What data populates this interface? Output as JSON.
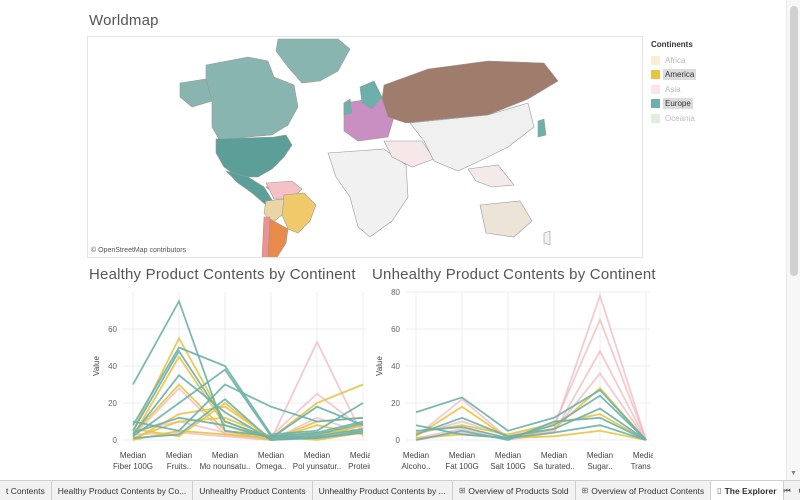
{
  "worldmap": {
    "title": "Worldmap",
    "credit": "© OpenStreetMap contributors"
  },
  "legend": {
    "title": "Continents",
    "items": [
      {
        "label": "Africa",
        "color": "#e8cf8a",
        "state": "dim"
      },
      {
        "label": "America",
        "color": "#e8c442",
        "state": "sel"
      },
      {
        "label": "Asia",
        "color": "#f2b8bd",
        "state": "dim"
      },
      {
        "label": "Europe",
        "color": "#6bb0aa",
        "state": "sel"
      },
      {
        "label": "Oceania",
        "color": "#a7cfa3",
        "state": "dim"
      }
    ]
  },
  "colors": {
    "america": "#e8c442",
    "europe": "#6bb0aa",
    "asia": "#f2b8bd",
    "russia": "#a07c6c",
    "greenland": "#89b5b1",
    "canada": "#89b5b1",
    "usa": "#5c9f99",
    "brazil": "#f0c96a",
    "argentina": "#e88a49",
    "chile": "#f09090",
    "grid": "#ececec"
  },
  "chart_data": [
    {
      "type": "line",
      "title": "Healthy Product Contents by Continent",
      "ylabel": "Value",
      "ylim": [
        0,
        80
      ],
      "yticks": [
        0,
        20,
        40,
        60
      ],
      "categories": [
        "Median Fiber 100G",
        "Median Fruits..",
        "Median Mo nounsatu..",
        "Median Omega..",
        "Median Pol yunsatur..",
        "Median Protein.."
      ],
      "series": [
        {
          "group": "europe",
          "values": [
            30,
            75,
            5,
            2,
            4,
            10
          ]
        },
        {
          "group": "europe",
          "values": [
            8,
            50,
            40,
            3,
            5,
            20
          ]
        },
        {
          "group": "europe",
          "values": [
            5,
            48,
            10,
            1,
            18,
            8
          ]
        },
        {
          "group": "europe",
          "values": [
            3,
            35,
            15,
            0,
            2,
            6
          ]
        },
        {
          "group": "europe",
          "values": [
            2,
            20,
            38,
            2,
            1,
            5
          ]
        },
        {
          "group": "europe",
          "values": [
            10,
            5,
            30,
            18,
            10,
            12
          ]
        },
        {
          "group": "europe",
          "values": [
            4,
            12,
            8,
            1,
            3,
            9
          ]
        },
        {
          "group": "europe",
          "values": [
            1,
            3,
            22,
            0,
            1,
            4
          ]
        },
        {
          "group": "america",
          "values": [
            5,
            55,
            10,
            1,
            20,
            30
          ]
        },
        {
          "group": "america",
          "values": [
            2,
            45,
            8,
            0,
            2,
            8
          ]
        },
        {
          "group": "america",
          "values": [
            0,
            14,
            18,
            1,
            4,
            5
          ]
        },
        {
          "group": "america",
          "values": [
            3,
            30,
            5,
            0,
            10,
            12
          ]
        },
        {
          "group": "america",
          "values": [
            1,
            10,
            12,
            2,
            0,
            4
          ]
        },
        {
          "group": "america",
          "values": [
            6,
            2,
            20,
            0,
            8,
            3
          ]
        },
        {
          "group": "america",
          "values": [
            0,
            5,
            3,
            1,
            2,
            8
          ]
        },
        {
          "group": "asia",
          "values": [
            3,
            4,
            2,
            0,
            53,
            2
          ]
        },
        {
          "group": "asia",
          "values": [
            5,
            10,
            4,
            2,
            25,
            6
          ]
        },
        {
          "group": "asia",
          "values": [
            2,
            28,
            3,
            0,
            12,
            4
          ]
        }
      ]
    },
    {
      "type": "line",
      "title": "Unhealthy Product Contents by Continent",
      "ylabel": "Value",
      "ylim": [
        0,
        80
      ],
      "yticks": [
        0,
        20,
        40,
        60,
        80
      ],
      "categories": [
        "Median Alcoho..",
        "Median Fat 100G",
        "Median Salt 100G",
        "Median Sa turated..",
        "Median Sugar..",
        "Median Trans F.."
      ],
      "series": [
        {
          "group": "europe",
          "values": [
            15,
            23,
            5,
            12,
            27,
            0
          ]
        },
        {
          "group": "europe",
          "values": [
            5,
            7,
            1,
            8,
            24,
            0
          ]
        },
        {
          "group": "europe",
          "values": [
            3,
            12,
            2,
            6,
            17,
            0
          ]
        },
        {
          "group": "europe",
          "values": [
            0,
            5,
            0,
            10,
            12,
            0
          ]
        },
        {
          "group": "europe",
          "values": [
            8,
            3,
            1,
            4,
            8,
            0
          ]
        },
        {
          "group": "america",
          "values": [
            2,
            18,
            1,
            6,
            28,
            0
          ]
        },
        {
          "group": "america",
          "values": [
            4,
            8,
            3,
            9,
            14,
            0
          ]
        },
        {
          "group": "america",
          "values": [
            1,
            3,
            1,
            2,
            5,
            0
          ]
        },
        {
          "group": "asia",
          "values": [
            2,
            22,
            1,
            6,
            78,
            0
          ]
        },
        {
          "group": "asia",
          "values": [
            3,
            10,
            2,
            8,
            65,
            0
          ]
        },
        {
          "group": "asia",
          "values": [
            1,
            6,
            0,
            4,
            48,
            0
          ]
        },
        {
          "group": "asia",
          "values": [
            0,
            4,
            1,
            5,
            36,
            0
          ]
        }
      ]
    }
  ],
  "tabs": [
    {
      "label": "t Contents",
      "icon": "",
      "active": false
    },
    {
      "label": "Healthy Product Contents by Co...",
      "icon": "",
      "active": false
    },
    {
      "label": "Unhealthy Product Contents",
      "icon": "",
      "active": false
    },
    {
      "label": "Unhealthy Product Contents by ...",
      "icon": "",
      "active": false
    },
    {
      "label": "Overview of Products Sold",
      "icon": "⊞",
      "active": false
    },
    {
      "label": "Overview of Product Contents",
      "icon": "⊞",
      "active": false
    },
    {
      "label": "The Explorer",
      "icon": "▯",
      "active": true
    }
  ],
  "tab_controls": {
    "first": "⏮",
    "stop": "■",
    "grid": "⊞",
    "more": "▾"
  }
}
